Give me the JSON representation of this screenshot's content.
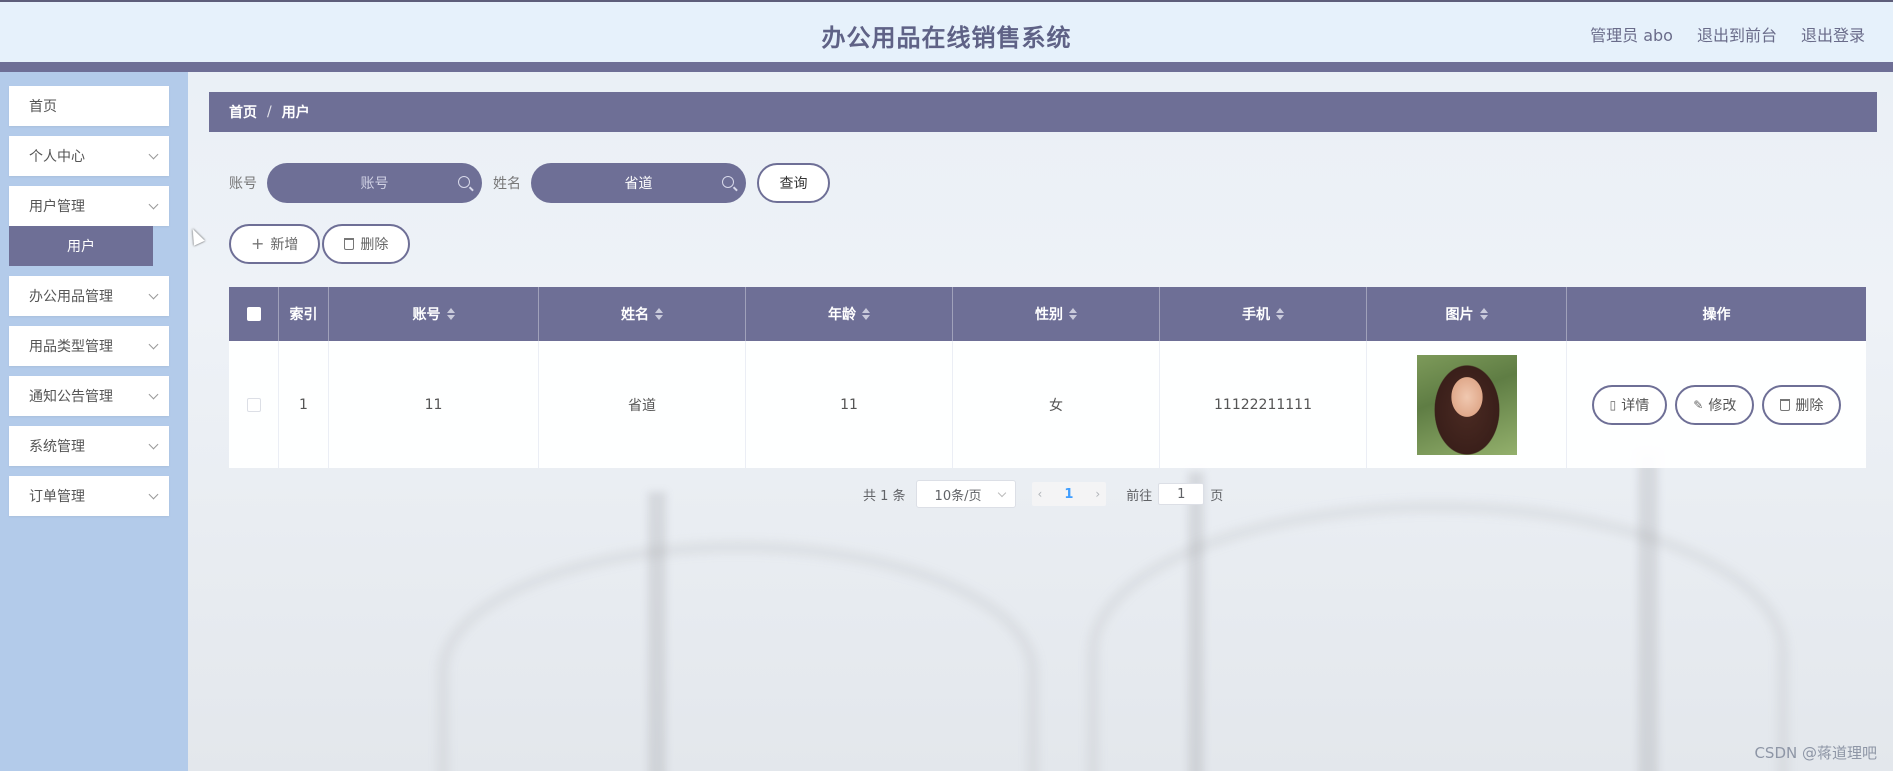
{
  "header": {
    "title": "办公用品在线销售系统",
    "admin": "管理员 abo",
    "to_front": "退出到前台",
    "logout": "退出登录"
  },
  "sidebar": {
    "items": [
      {
        "label": "首页",
        "has_children": false
      },
      {
        "label": "个人中心",
        "has_children": true
      },
      {
        "label": "用户管理",
        "has_children": true
      },
      {
        "label": "办公用品管理",
        "has_children": true
      },
      {
        "label": "用品类型管理",
        "has_children": true
      },
      {
        "label": "通知公告管理",
        "has_children": true
      },
      {
        "label": "系统管理",
        "has_children": true
      },
      {
        "label": "订单管理",
        "has_children": true
      }
    ],
    "active_sub": "用户"
  },
  "breadcrumb": {
    "home": "首页",
    "sep": "/",
    "current": "用户"
  },
  "search": {
    "account_label": "账号",
    "account_placeholder": "账号",
    "name_label": "姓名",
    "name_value": "省道",
    "query_button": "查询"
  },
  "actions": {
    "add": "新增",
    "delete": "删除"
  },
  "table": {
    "headers": [
      "索引",
      "账号",
      "姓名",
      "年龄",
      "性别",
      "手机",
      "图片",
      "操作"
    ],
    "rows": [
      {
        "index": "1",
        "account": "11",
        "name": "省道",
        "age": "11",
        "gender": "女",
        "phone": "11122211111"
      }
    ],
    "row_actions": {
      "detail": "详情",
      "edit": "修改",
      "delete": "删除"
    }
  },
  "pagination": {
    "total": "共 1 条",
    "page_size": "10条/页",
    "current_page": "1",
    "goto_label": "前往",
    "goto_value": "1",
    "page_unit": "页"
  },
  "watermark": "CSDN @蒋道理吧",
  "colors": {
    "primary": "#6e6f96",
    "sidebar": "#b3cbea",
    "header": "#e6f1fb"
  }
}
